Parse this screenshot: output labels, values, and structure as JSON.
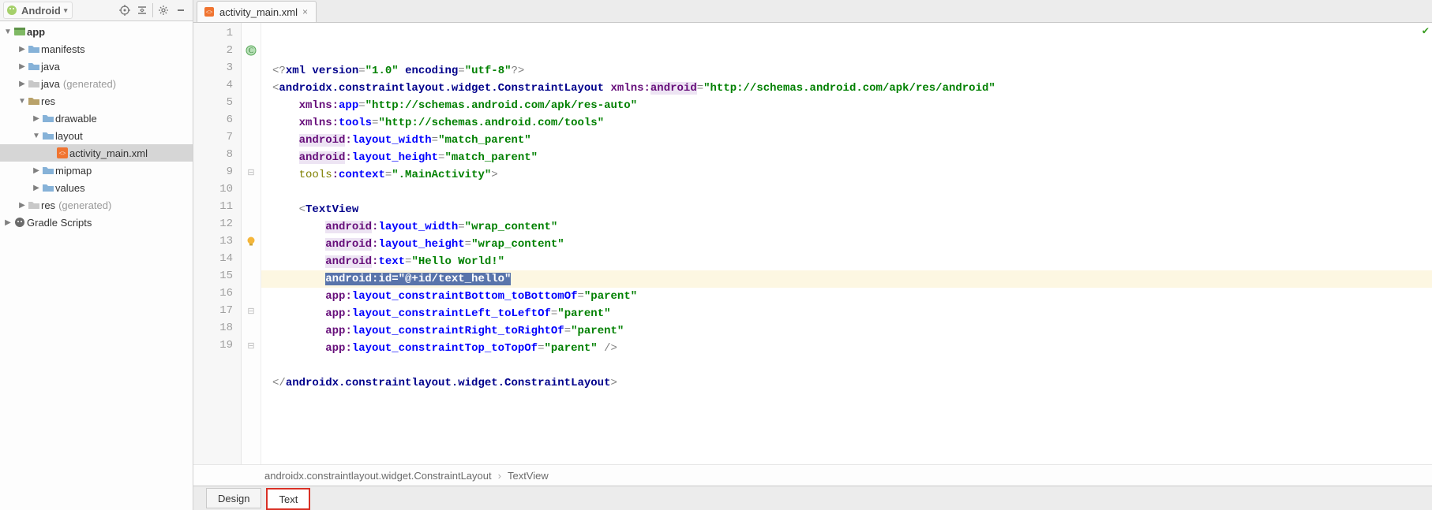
{
  "sidebar": {
    "mode_label": "Android",
    "tree": [
      {
        "depth": 0,
        "arrow": "down",
        "icon": "module",
        "label": "app",
        "suffix": "",
        "bold": true,
        "selected": false
      },
      {
        "depth": 1,
        "arrow": "right",
        "icon": "folder",
        "label": "manifests",
        "suffix": "",
        "bold": false,
        "selected": false
      },
      {
        "depth": 1,
        "arrow": "right",
        "icon": "folder",
        "label": "java",
        "suffix": "",
        "bold": false,
        "selected": false
      },
      {
        "depth": 1,
        "arrow": "right",
        "icon": "folder-gen",
        "label": "java",
        "suffix": "(generated)",
        "bold": false,
        "selected": false
      },
      {
        "depth": 1,
        "arrow": "down",
        "icon": "folder-res",
        "label": "res",
        "suffix": "",
        "bold": false,
        "selected": false
      },
      {
        "depth": 2,
        "arrow": "right",
        "icon": "folder",
        "label": "drawable",
        "suffix": "",
        "bold": false,
        "selected": false
      },
      {
        "depth": 2,
        "arrow": "down",
        "icon": "folder",
        "label": "layout",
        "suffix": "",
        "bold": false,
        "selected": false
      },
      {
        "depth": 3,
        "arrow": "",
        "icon": "xml",
        "label": "activity_main.xml",
        "suffix": "",
        "bold": false,
        "selected": true
      },
      {
        "depth": 2,
        "arrow": "right",
        "icon": "folder",
        "label": "mipmap",
        "suffix": "",
        "bold": false,
        "selected": false
      },
      {
        "depth": 2,
        "arrow": "right",
        "icon": "folder",
        "label": "values",
        "suffix": "",
        "bold": false,
        "selected": false
      },
      {
        "depth": 1,
        "arrow": "right",
        "icon": "folder-gen",
        "label": "res",
        "suffix": "(generated)",
        "bold": false,
        "selected": false
      },
      {
        "depth": 0,
        "arrow": "right",
        "icon": "gradle",
        "label": "Gradle Scripts",
        "suffix": "",
        "bold": false,
        "selected": false
      }
    ]
  },
  "tab": {
    "title": "activity_main.xml"
  },
  "code": {
    "lines": [
      {
        "n": 1,
        "marker": "",
        "hl": false,
        "tokens": [
          {
            "c": "mt",
            "t": "<?"
          },
          {
            "c": "tag",
            "t": "xml version"
          },
          {
            "c": "mt",
            "t": "="
          },
          {
            "c": "lstr",
            "t": "\"1.0\""
          },
          {
            "c": "mt",
            "t": " "
          },
          {
            "c": "tag",
            "t": "encoding"
          },
          {
            "c": "mt",
            "t": "="
          },
          {
            "c": "lstr",
            "t": "\"utf-8\""
          },
          {
            "c": "mt",
            "t": "?>"
          }
        ]
      },
      {
        "n": 2,
        "marker": "class",
        "hl": false,
        "tokens": [
          {
            "c": "mt",
            "t": "<"
          },
          {
            "c": "tag",
            "t": "androidx.constraintlayout.widget.ConstraintLayout"
          },
          {
            "c": "mt",
            "t": " "
          },
          {
            "c": "ns-x",
            "t": "xmlns:"
          },
          {
            "c": "ns-a",
            "t": "android"
          },
          {
            "c": "mt",
            "t": "="
          },
          {
            "c": "lstr",
            "t": "\"http://schemas.android.com/apk/res/android\""
          }
        ]
      },
      {
        "n": 3,
        "marker": "",
        "hl": false,
        "tokens": [
          {
            "c": "",
            "t": "    "
          },
          {
            "c": "ns-x",
            "t": "xmlns:"
          },
          {
            "c": "attr",
            "t": "app"
          },
          {
            "c": "mt",
            "t": "="
          },
          {
            "c": "lstr",
            "t": "\"http://schemas.android.com/apk/res-auto\""
          }
        ]
      },
      {
        "n": 4,
        "marker": "",
        "hl": false,
        "tokens": [
          {
            "c": "",
            "t": "    "
          },
          {
            "c": "ns-x",
            "t": "xmlns:"
          },
          {
            "c": "attr",
            "t": "tools"
          },
          {
            "c": "mt",
            "t": "="
          },
          {
            "c": "lstr",
            "t": "\"http://schemas.android.com/tools\""
          }
        ]
      },
      {
        "n": 5,
        "marker": "",
        "hl": false,
        "tokens": [
          {
            "c": "",
            "t": "    "
          },
          {
            "c": "ns-a",
            "t": "android"
          },
          {
            "c": "ns-x",
            "t": ":"
          },
          {
            "c": "attr",
            "t": "layout_width"
          },
          {
            "c": "mt",
            "t": "="
          },
          {
            "c": "lstr",
            "t": "\"match_parent\""
          }
        ]
      },
      {
        "n": 6,
        "marker": "",
        "hl": false,
        "tokens": [
          {
            "c": "",
            "t": "    "
          },
          {
            "c": "ns-a",
            "t": "android"
          },
          {
            "c": "ns-x",
            "t": ":"
          },
          {
            "c": "attr",
            "t": "layout_height"
          },
          {
            "c": "mt",
            "t": "="
          },
          {
            "c": "lstr",
            "t": "\"match_parent\""
          }
        ]
      },
      {
        "n": 7,
        "marker": "",
        "hl": false,
        "tokens": [
          {
            "c": "",
            "t": "    "
          },
          {
            "c": "ns-f",
            "t": "tools"
          },
          {
            "c": "ns-x",
            "t": ":"
          },
          {
            "c": "attr",
            "t": "context"
          },
          {
            "c": "mt",
            "t": "="
          },
          {
            "c": "lstr",
            "t": "\".MainActivity\""
          },
          {
            "c": "mt",
            "t": ">"
          }
        ]
      },
      {
        "n": 8,
        "marker": "",
        "hl": false,
        "tokens": [
          {
            "c": "",
            "t": ""
          }
        ]
      },
      {
        "n": 9,
        "marker": "fold",
        "hl": false,
        "tokens": [
          {
            "c": "",
            "t": "    "
          },
          {
            "c": "mt",
            "t": "<"
          },
          {
            "c": "tag",
            "t": "TextView"
          }
        ]
      },
      {
        "n": 10,
        "marker": "",
        "hl": false,
        "tokens": [
          {
            "c": "",
            "t": "        "
          },
          {
            "c": "ns-a",
            "t": "android"
          },
          {
            "c": "ns-x",
            "t": ":"
          },
          {
            "c": "attr",
            "t": "layout_width"
          },
          {
            "c": "mt",
            "t": "="
          },
          {
            "c": "lstr",
            "t": "\"wrap_content\""
          }
        ]
      },
      {
        "n": 11,
        "marker": "",
        "hl": false,
        "tokens": [
          {
            "c": "",
            "t": "        "
          },
          {
            "c": "ns-a",
            "t": "android"
          },
          {
            "c": "ns-x",
            "t": ":"
          },
          {
            "c": "attr",
            "t": "layout_height"
          },
          {
            "c": "mt",
            "t": "="
          },
          {
            "c": "lstr",
            "t": "\"wrap_content\""
          }
        ]
      },
      {
        "n": 12,
        "marker": "",
        "hl": false,
        "tokens": [
          {
            "c": "",
            "t": "        "
          },
          {
            "c": "ns-a",
            "t": "android"
          },
          {
            "c": "ns-x",
            "t": ":"
          },
          {
            "c": "attr",
            "t": "text"
          },
          {
            "c": "mt",
            "t": "="
          },
          {
            "c": "lstr",
            "t": "\"Hello World!\""
          }
        ]
      },
      {
        "n": 13,
        "marker": "bulb",
        "hl": true,
        "tokens": [
          {
            "c": "",
            "t": "        "
          },
          {
            "c": "sel",
            "t": "android:id=\"@+id/text_hello\""
          }
        ]
      },
      {
        "n": 14,
        "marker": "",
        "hl": false,
        "tokens": [
          {
            "c": "",
            "t": "        "
          },
          {
            "c": "ns-x",
            "t": "app"
          },
          {
            "c": "ns-x",
            "t": ":"
          },
          {
            "c": "attr",
            "t": "layout_constraintBottom_toBottomOf"
          },
          {
            "c": "mt",
            "t": "="
          },
          {
            "c": "lstr",
            "t": "\"parent\""
          }
        ]
      },
      {
        "n": 15,
        "marker": "",
        "hl": false,
        "tokens": [
          {
            "c": "",
            "t": "        "
          },
          {
            "c": "ns-x",
            "t": "app"
          },
          {
            "c": "ns-x",
            "t": ":"
          },
          {
            "c": "attr",
            "t": "layout_constraintLeft_toLeftOf"
          },
          {
            "c": "mt",
            "t": "="
          },
          {
            "c": "lstr",
            "t": "\"parent\""
          }
        ]
      },
      {
        "n": 16,
        "marker": "",
        "hl": false,
        "tokens": [
          {
            "c": "",
            "t": "        "
          },
          {
            "c": "ns-x",
            "t": "app"
          },
          {
            "c": "ns-x",
            "t": ":"
          },
          {
            "c": "attr",
            "t": "layout_constraintRight_toRightOf"
          },
          {
            "c": "mt",
            "t": "="
          },
          {
            "c": "lstr",
            "t": "\"parent\""
          }
        ]
      },
      {
        "n": 17,
        "marker": "fold",
        "hl": false,
        "tokens": [
          {
            "c": "",
            "t": "        "
          },
          {
            "c": "ns-x",
            "t": "app"
          },
          {
            "c": "ns-x",
            "t": ":"
          },
          {
            "c": "attr",
            "t": "layout_constraintTop_toTopOf"
          },
          {
            "c": "mt",
            "t": "="
          },
          {
            "c": "lstr",
            "t": "\"parent\""
          },
          {
            "c": "mt",
            "t": " />"
          }
        ]
      },
      {
        "n": 18,
        "marker": "",
        "hl": false,
        "tokens": [
          {
            "c": "",
            "t": ""
          }
        ]
      },
      {
        "n": 19,
        "marker": "fold",
        "hl": false,
        "tokens": [
          {
            "c": "mt",
            "t": "</"
          },
          {
            "c": "tag",
            "t": "androidx.constraintlayout.widget.ConstraintLayout"
          },
          {
            "c": "mt",
            "t": ">"
          }
        ]
      }
    ]
  },
  "breadcrumb": {
    "a": "androidx.constraintlayout.widget.ConstraintLayout",
    "b": "TextView"
  },
  "bottom_tabs": {
    "design": "Design",
    "text": "Text"
  }
}
